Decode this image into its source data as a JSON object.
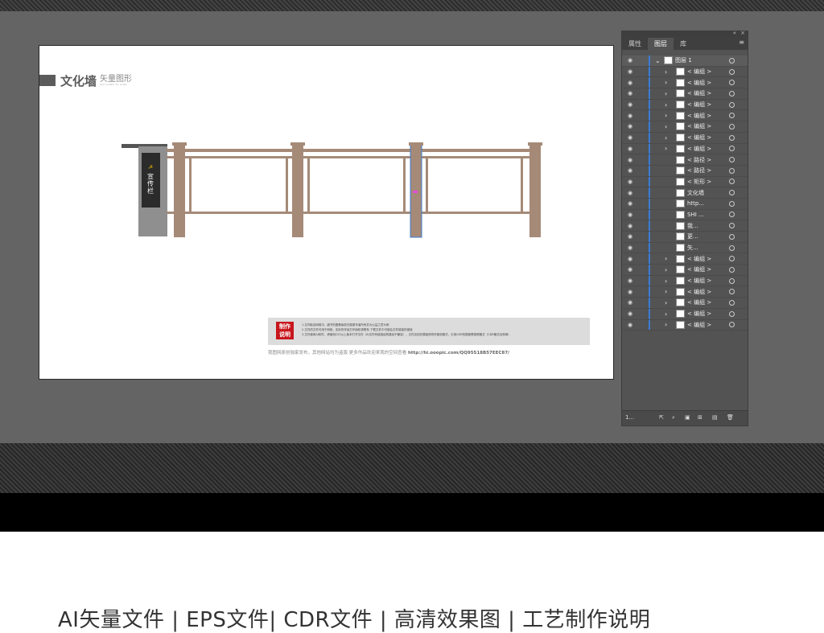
{
  "artboard": {
    "title_main": "文化墙",
    "title_sub": "矢量图形",
    "title_sub_small": "SHI LIANG TU XING",
    "sign_text": "宣传栏"
  },
  "notes": {
    "badge_line1": "制作",
    "badge_line2": "说明",
    "line1": "1.文件取自网络中，细节的图像版权归属原作者所有并为公益之意为例",
    "line2": "2.文件的文件可用于网络，实际的作品打印版权请联系 下载文件中可能会文件链接的错误",
    "line3": "3.文件使用AI软件，请使用CS3以上版本打开文件（AI文件有链接结构路径不兼容），文件应用在模板修改时使用格式，引用CDR的图案需按照格式（CDR格式合转换）",
    "footer_text": "我图网原创独家发布，其他网站均为盗版  更多作品欢迎来我的空间查看",
    "footer_url": "http://hi.ooopic.com/QQ95518B57EEC87/"
  },
  "layers_panel": {
    "tabs": [
      "属性",
      "图层",
      "库"
    ],
    "active_tab": "图层",
    "close_glyph": "×",
    "collapse_glyph": "«",
    "menu_glyph": "≡",
    "top_layer": "图层 1",
    "rows": [
      {
        "label": "< 编组 >",
        "chev": true
      },
      {
        "label": "< 编组 >",
        "chev": true
      },
      {
        "label": "< 编组 >",
        "chev": true
      },
      {
        "label": "< 编组 >",
        "chev": true
      },
      {
        "label": "< 编组 >",
        "chev": true
      },
      {
        "label": "< 编组 >",
        "chev": true
      },
      {
        "label": "< 编组 >",
        "chev": true
      },
      {
        "label": "< 编组 >",
        "chev": true
      },
      {
        "label": "< 路径 >",
        "chev": false
      },
      {
        "label": "< 路径 >",
        "chev": false
      },
      {
        "label": "< 矩形 >",
        "chev": false
      },
      {
        "label": "文化墙",
        "chev": false
      },
      {
        "label": "http...",
        "chev": false
      },
      {
        "label": "SHI ...",
        "chev": false
      },
      {
        "label": "我...",
        "chev": false
      },
      {
        "label": "更...",
        "chev": false
      },
      {
        "label": "矢...",
        "chev": false
      },
      {
        "label": "< 编组 >",
        "chev": true
      },
      {
        "label": "< 编组 >",
        "chev": true
      },
      {
        "label": "< 编组 >",
        "chev": true
      },
      {
        "label": "< 编组 >",
        "chev": true
      },
      {
        "label": "< 编组 >",
        "chev": true
      },
      {
        "label": "< 编组 >",
        "chev": true
      },
      {
        "label": "< 编组 >",
        "chev": true
      }
    ],
    "layer_count": "1..."
  },
  "caption": "AI矢量文件 | EPS文件| CDR文件 | 高清效果图 | 工艺制作说明",
  "colors": {
    "fence": "#a58a78",
    "sign_dark": "#2b2b2b",
    "sign_grey": "#8f8f8f",
    "select_blue": "#3b7cd6",
    "badge_red": "#c8161d"
  }
}
